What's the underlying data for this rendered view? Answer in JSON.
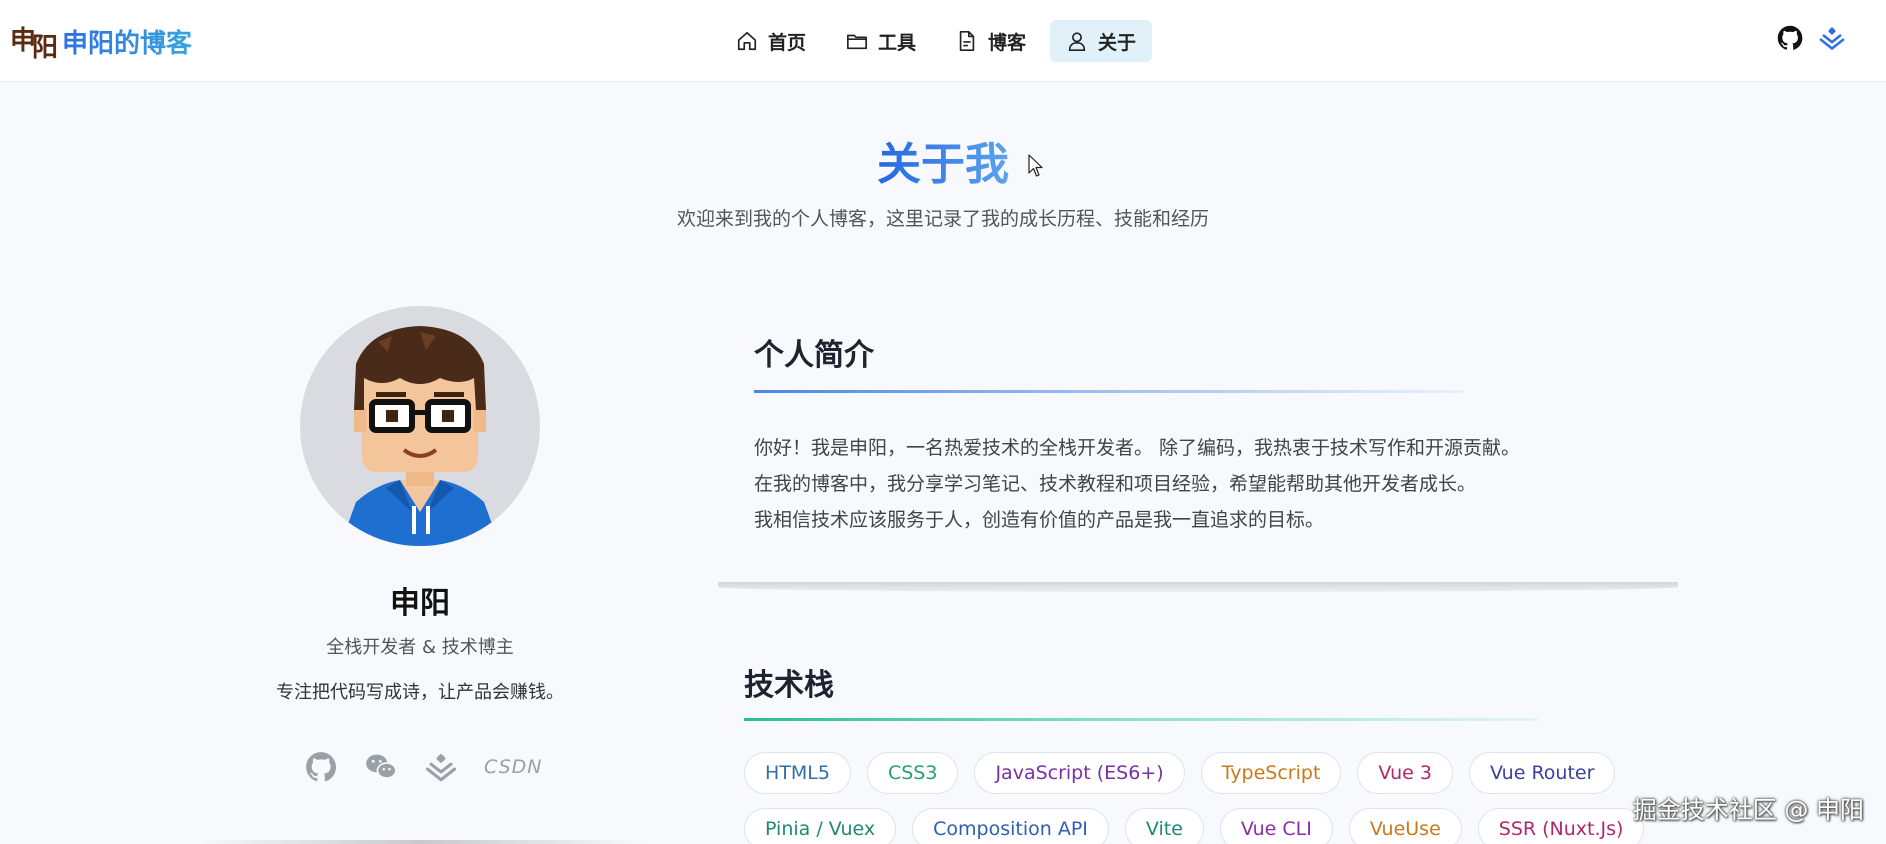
{
  "header": {
    "logo_char_1": "申",
    "logo_char_2": "阳",
    "brand_name": "申阳的博客",
    "nav": [
      {
        "label": "首页",
        "icon": "home-icon"
      },
      {
        "label": "工具",
        "icon": "folder-icon"
      },
      {
        "label": "博客",
        "icon": "document-icon"
      },
      {
        "label": "关于",
        "icon": "user-icon",
        "active": true
      }
    ],
    "right_icons": [
      "github-icon",
      "juejin-icon"
    ]
  },
  "hero": {
    "title": "关于我",
    "subtitle": "欢迎来到我的个人博客，这里记录了我的成长历程、技能和经历"
  },
  "profile": {
    "name": "申阳",
    "role": "全栈开发者 & 技术博主",
    "motto": "专注把代码写成诗，让产品会赚钱。",
    "social": [
      "github-icon",
      "wechat-icon",
      "juejin-icon",
      "csdn-icon"
    ],
    "csdn_label": "CSDN"
  },
  "intro": {
    "title": "个人简介",
    "lines": [
      "你好！我是申阳，一名热爱技术的全栈开发者。 除了编码，我热衷于技术写作和开源贡献。",
      "在我的博客中，我分享学习笔记、技术教程和项目经验，希望能帮助其他开发者成长。",
      "我相信技术应该服务于人，创造有价值的产品是我一直追求的目标。"
    ]
  },
  "tech": {
    "title": "技术栈",
    "tags": [
      {
        "label": "HTML5",
        "color": "#2f6fb0"
      },
      {
        "label": "CSS3",
        "color": "#2a9d78"
      },
      {
        "label": "JavaScript (ES6+)",
        "color": "#7a2fa8"
      },
      {
        "label": "TypeScript",
        "color": "#c9791a"
      },
      {
        "label": "Vue 3",
        "color": "#b0286a"
      },
      {
        "label": "Vue Router",
        "color": "#3b3fa0"
      },
      {
        "label": "Pinia / Vuex",
        "color": "#1f8a6e"
      },
      {
        "label": "Composition API",
        "color": "#2f5fb0"
      },
      {
        "label": "Vite",
        "color": "#1f8a6e"
      },
      {
        "label": "Vue CLI",
        "color": "#8a2fa8"
      },
      {
        "label": "VueUse",
        "color": "#c9791a"
      },
      {
        "label": "SSR (Nuxt.Js)",
        "color": "#b0286a"
      }
    ]
  },
  "watermark": "掘金技术社区 @ 申阳",
  "colors": {
    "accent": "#2f6fe0",
    "nav_active_bg": "#e1f1fa",
    "tech_line": "#2dbf86"
  }
}
